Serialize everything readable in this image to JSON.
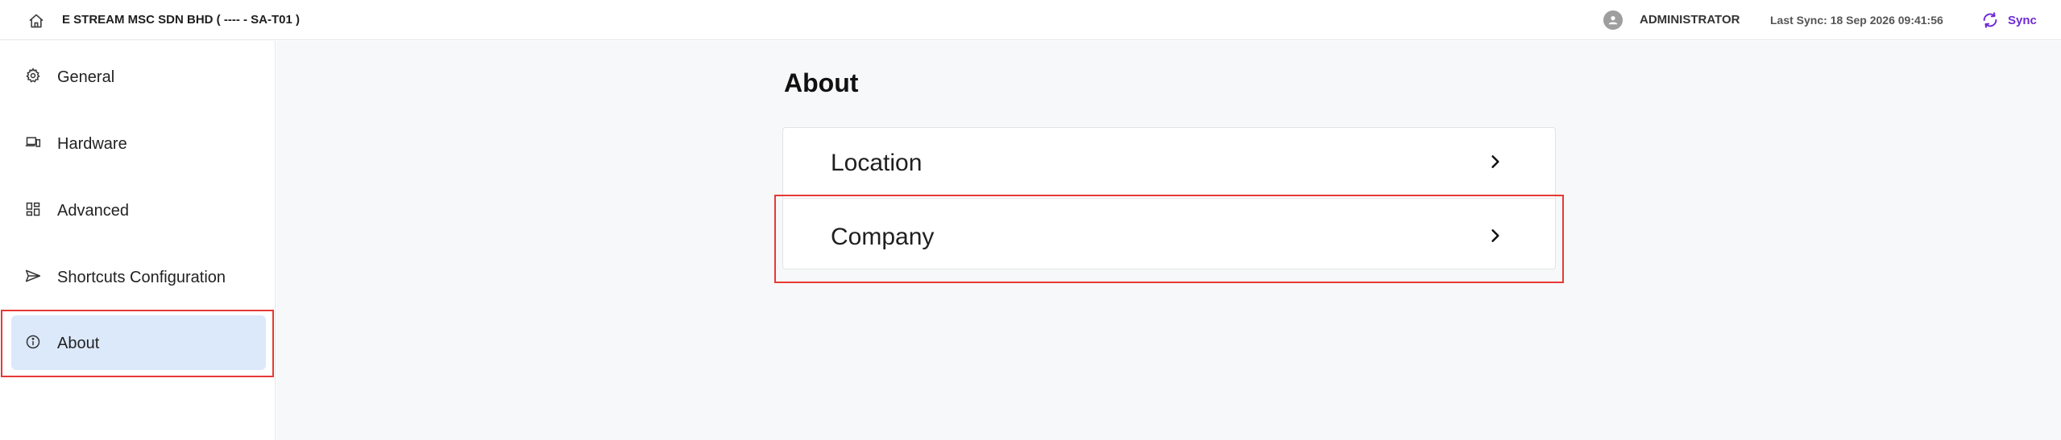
{
  "header": {
    "company_title": "E STREAM MSC SDN BHD ( ---- - SA-T01 )",
    "user_name": "ADMINISTRATOR",
    "last_sync": "Last Sync: 18 Sep 2026 09:41:56",
    "sync_label": "Sync",
    "accent_color": "#6f2bd6"
  },
  "sidebar": {
    "items": [
      {
        "label": "General",
        "icon": "gear-icon"
      },
      {
        "label": "Hardware",
        "icon": "devices-icon"
      },
      {
        "label": "Advanced",
        "icon": "dashboard-icon"
      },
      {
        "label": "Shortcuts Configuration",
        "icon": "send-icon"
      },
      {
        "label": "About",
        "icon": "info-icon",
        "active": true
      }
    ],
    "active_color": "#dce9fb"
  },
  "main": {
    "title": "About",
    "rows": [
      {
        "label": "Location"
      },
      {
        "label": "Company"
      }
    ]
  },
  "highlight_color": "#e53935"
}
